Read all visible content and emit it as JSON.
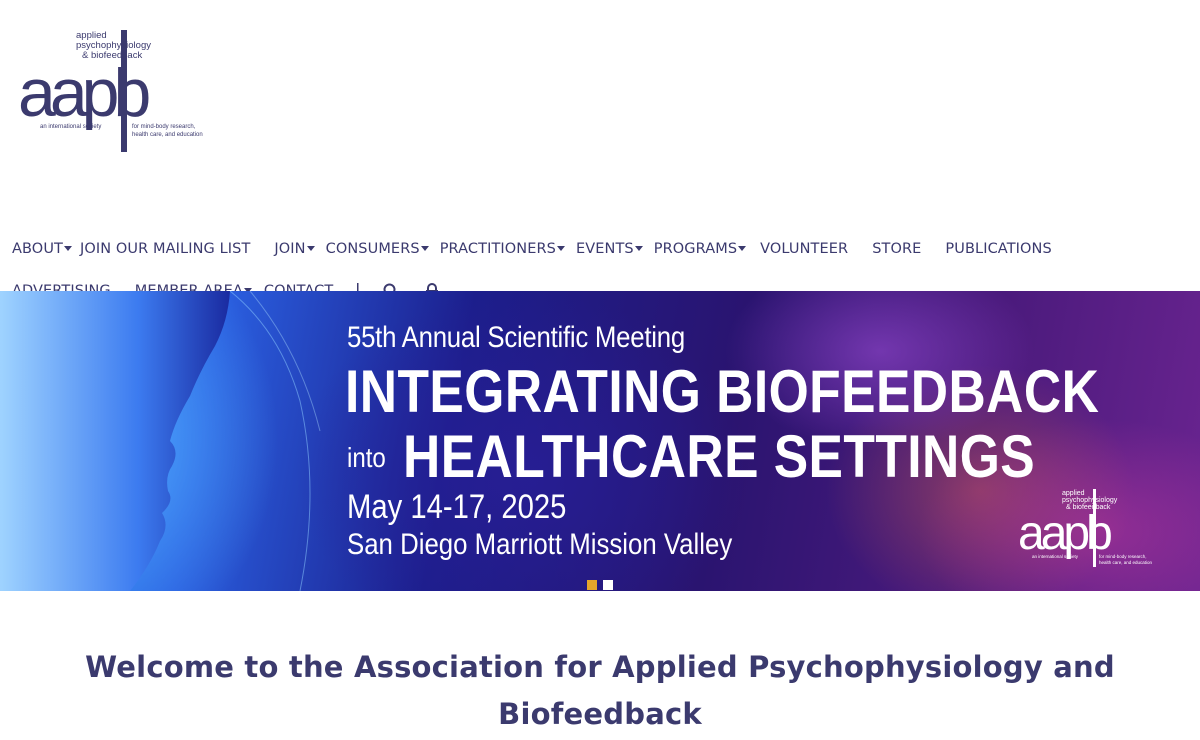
{
  "logo": {
    "name": "aapb",
    "tagline_top": [
      "applied",
      "psychophysiology",
      "& biofeedback"
    ],
    "tagline_left": "an international society",
    "tagline_right": [
      "for mind-body research,",
      "health care, and education"
    ]
  },
  "nav": {
    "row1": [
      {
        "label": "ABOUT",
        "dropdown": true
      },
      {
        "label": "JOIN OUR MAILING LIST",
        "dropdown": false
      },
      {
        "label": "JOIN",
        "dropdown": true
      },
      {
        "label": "CONSUMERS",
        "dropdown": true
      },
      {
        "label": "PRACTITIONERS",
        "dropdown": true
      },
      {
        "label": "EVENTS",
        "dropdown": true
      },
      {
        "label": "PROGRAMS",
        "dropdown": true
      },
      {
        "label": "VOLUNTEER",
        "dropdown": false
      },
      {
        "label": "STORE",
        "dropdown": false
      },
      {
        "label": "PUBLICATIONS",
        "dropdown": false
      }
    ],
    "row2": [
      {
        "label": "ADVERTISING",
        "dropdown": false
      },
      {
        "label": "MEMBER AREA",
        "dropdown": true
      },
      {
        "label": "CONTACT",
        "dropdown": false
      }
    ],
    "icons": [
      "search-icon",
      "lock-icon"
    ]
  },
  "banner": {
    "subtitle": "55th Annual Scientific Meeting",
    "headline_1": "INTEGRATING BIOFEEDBACK",
    "into": "into",
    "headline_2": "HEALTHCARE SETTINGS",
    "date": "May 14-17, 2025",
    "venue": "San Diego Marriott Mission Valley",
    "slides_total": 2,
    "active_slide": 1
  },
  "welcome": {
    "heading": "Welcome to the Association for Applied Psychophysiology and Biofeedback"
  },
  "colors": {
    "brand": "#3b3a6e",
    "dot_active": "#e6a52a",
    "dot_inactive": "#ffffff"
  }
}
